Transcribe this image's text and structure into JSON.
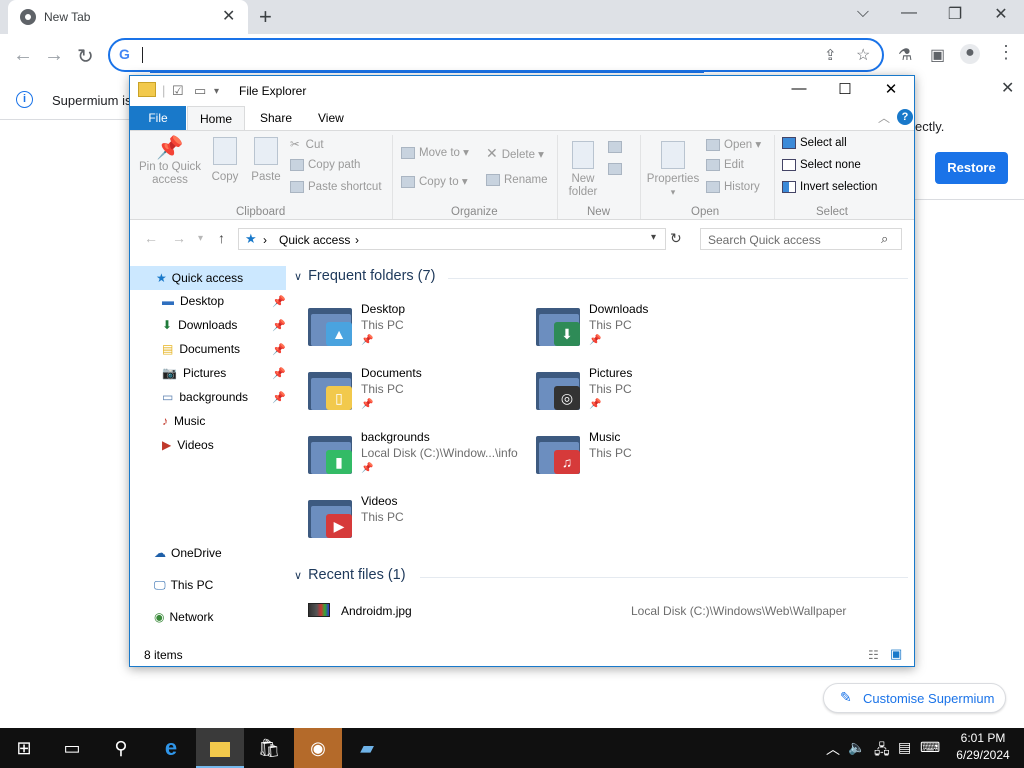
{
  "browser": {
    "tab_title": "New Tab",
    "new_tab_symbol": "+",
    "close_symbol": "✕",
    "omnibox_value": "",
    "window_minimize": "⌵",
    "window_minimize2": "—",
    "window_restore": "❐",
    "window_close": "✕"
  },
  "infobar": {
    "text": "Supermium is",
    "text_right": "ectly.",
    "restore_label": "Restore"
  },
  "customise": {
    "label": "Customise Supermium"
  },
  "explorer": {
    "title": "File Explorer",
    "tabs": {
      "file": "File",
      "home": "Home",
      "share": "Share",
      "view": "View"
    },
    "ribbon": {
      "pin_to_quick_access": "Pin to Quick\naccess",
      "copy": "Copy",
      "paste": "Paste",
      "cut": "Cut",
      "copy_path": "Copy path",
      "paste_shortcut": "Paste shortcut",
      "move_to": "Move to",
      "copy_to": "Copy to",
      "delete": "Delete",
      "rename": "Rename",
      "new_folder": "New\nfolder",
      "properties": "Properties",
      "open": "Open",
      "edit": "Edit",
      "history": "History",
      "select_all": "Select all",
      "select_none": "Select none",
      "invert_selection": "Invert selection",
      "groups": {
        "clipboard": "Clipboard",
        "organize": "Organize",
        "new": "New",
        "open": "Open",
        "select": "Select"
      }
    },
    "address": {
      "crumb": "Quick access"
    },
    "search_placeholder": "Search Quick access",
    "nav": {
      "quick_access": "Quick access",
      "items": [
        {
          "label": "Desktop",
          "pinned": true
        },
        {
          "label": "Downloads",
          "pinned": true
        },
        {
          "label": "Documents",
          "pinned": true
        },
        {
          "label": "Pictures",
          "pinned": true
        },
        {
          "label": "backgrounds",
          "pinned": true
        },
        {
          "label": "Music",
          "pinned": false
        },
        {
          "label": "Videos",
          "pinned": false
        }
      ],
      "onedrive": "OneDrive",
      "this_pc": "This PC",
      "network": "Network"
    },
    "frequent_header": "Frequent folders (7)",
    "folders": [
      {
        "name": "Desktop",
        "sub": "This PC",
        "pinned": true,
        "badge": "desktop"
      },
      {
        "name": "Downloads",
        "sub": "This PC",
        "pinned": true,
        "badge": "download"
      },
      {
        "name": "Documents",
        "sub": "This PC",
        "pinned": true,
        "badge": "document"
      },
      {
        "name": "Pictures",
        "sub": "This PC",
        "pinned": true,
        "badge": "camera"
      },
      {
        "name": "backgrounds",
        "sub": "Local Disk (C:)\\Window...\\info",
        "pinned": true,
        "badge": "none"
      },
      {
        "name": "Music",
        "sub": "This PC",
        "pinned": false,
        "badge": "music"
      },
      {
        "name": "Videos",
        "sub": "This PC",
        "pinned": false,
        "badge": "video"
      }
    ],
    "recent_header": "Recent files (1)",
    "recent": [
      {
        "name": "Androidm.jpg",
        "path": "Local Disk (C:)\\Windows\\Web\\Wallpaper"
      }
    ],
    "status": "8 items"
  },
  "taskbar": {
    "time": "6:01 PM",
    "date": "6/29/2024"
  },
  "colors": {
    "accent": "#1979ca",
    "chrome_blue": "#1a73e8"
  }
}
